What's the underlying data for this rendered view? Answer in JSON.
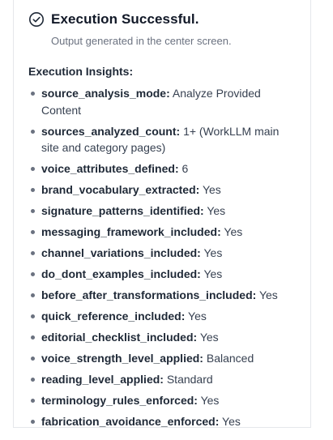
{
  "header": {
    "title": "Execution Successful.",
    "subtitle": "Output generated in the center screen."
  },
  "insights": {
    "heading": "Execution Insights:",
    "items": [
      {
        "key": "source_analysis_mode:",
        "value": "Analyze Provided Content"
      },
      {
        "key": "sources_analyzed_count:",
        "value": "1+ (WorkLLM main site and category pages)"
      },
      {
        "key": "voice_attributes_defined:",
        "value": "6"
      },
      {
        "key": "brand_vocabulary_extracted:",
        "value": "Yes"
      },
      {
        "key": "signature_patterns_identified:",
        "value": "Yes"
      },
      {
        "key": "messaging_framework_included:",
        "value": "Yes"
      },
      {
        "key": "channel_variations_included:",
        "value": "Yes"
      },
      {
        "key": "do_dont_examples_included:",
        "value": "Yes"
      },
      {
        "key": "before_after_transformations_included:",
        "value": "Yes"
      },
      {
        "key": "quick_reference_included:",
        "value": "Yes"
      },
      {
        "key": "editorial_checklist_included:",
        "value": "Yes"
      },
      {
        "key": "voice_strength_level_applied:",
        "value": "Balanced"
      },
      {
        "key": "reading_level_applied:",
        "value": "Standard"
      },
      {
        "key": "terminology_rules_enforced:",
        "value": "Yes"
      },
      {
        "key": "fabrication_avoidance_enforced:",
        "value": "Yes"
      }
    ]
  },
  "icons": {
    "status": "check-circle-icon"
  },
  "colors": {
    "text": "#1f2937",
    "muted": "#6b7280",
    "border": "#e5e7eb"
  }
}
